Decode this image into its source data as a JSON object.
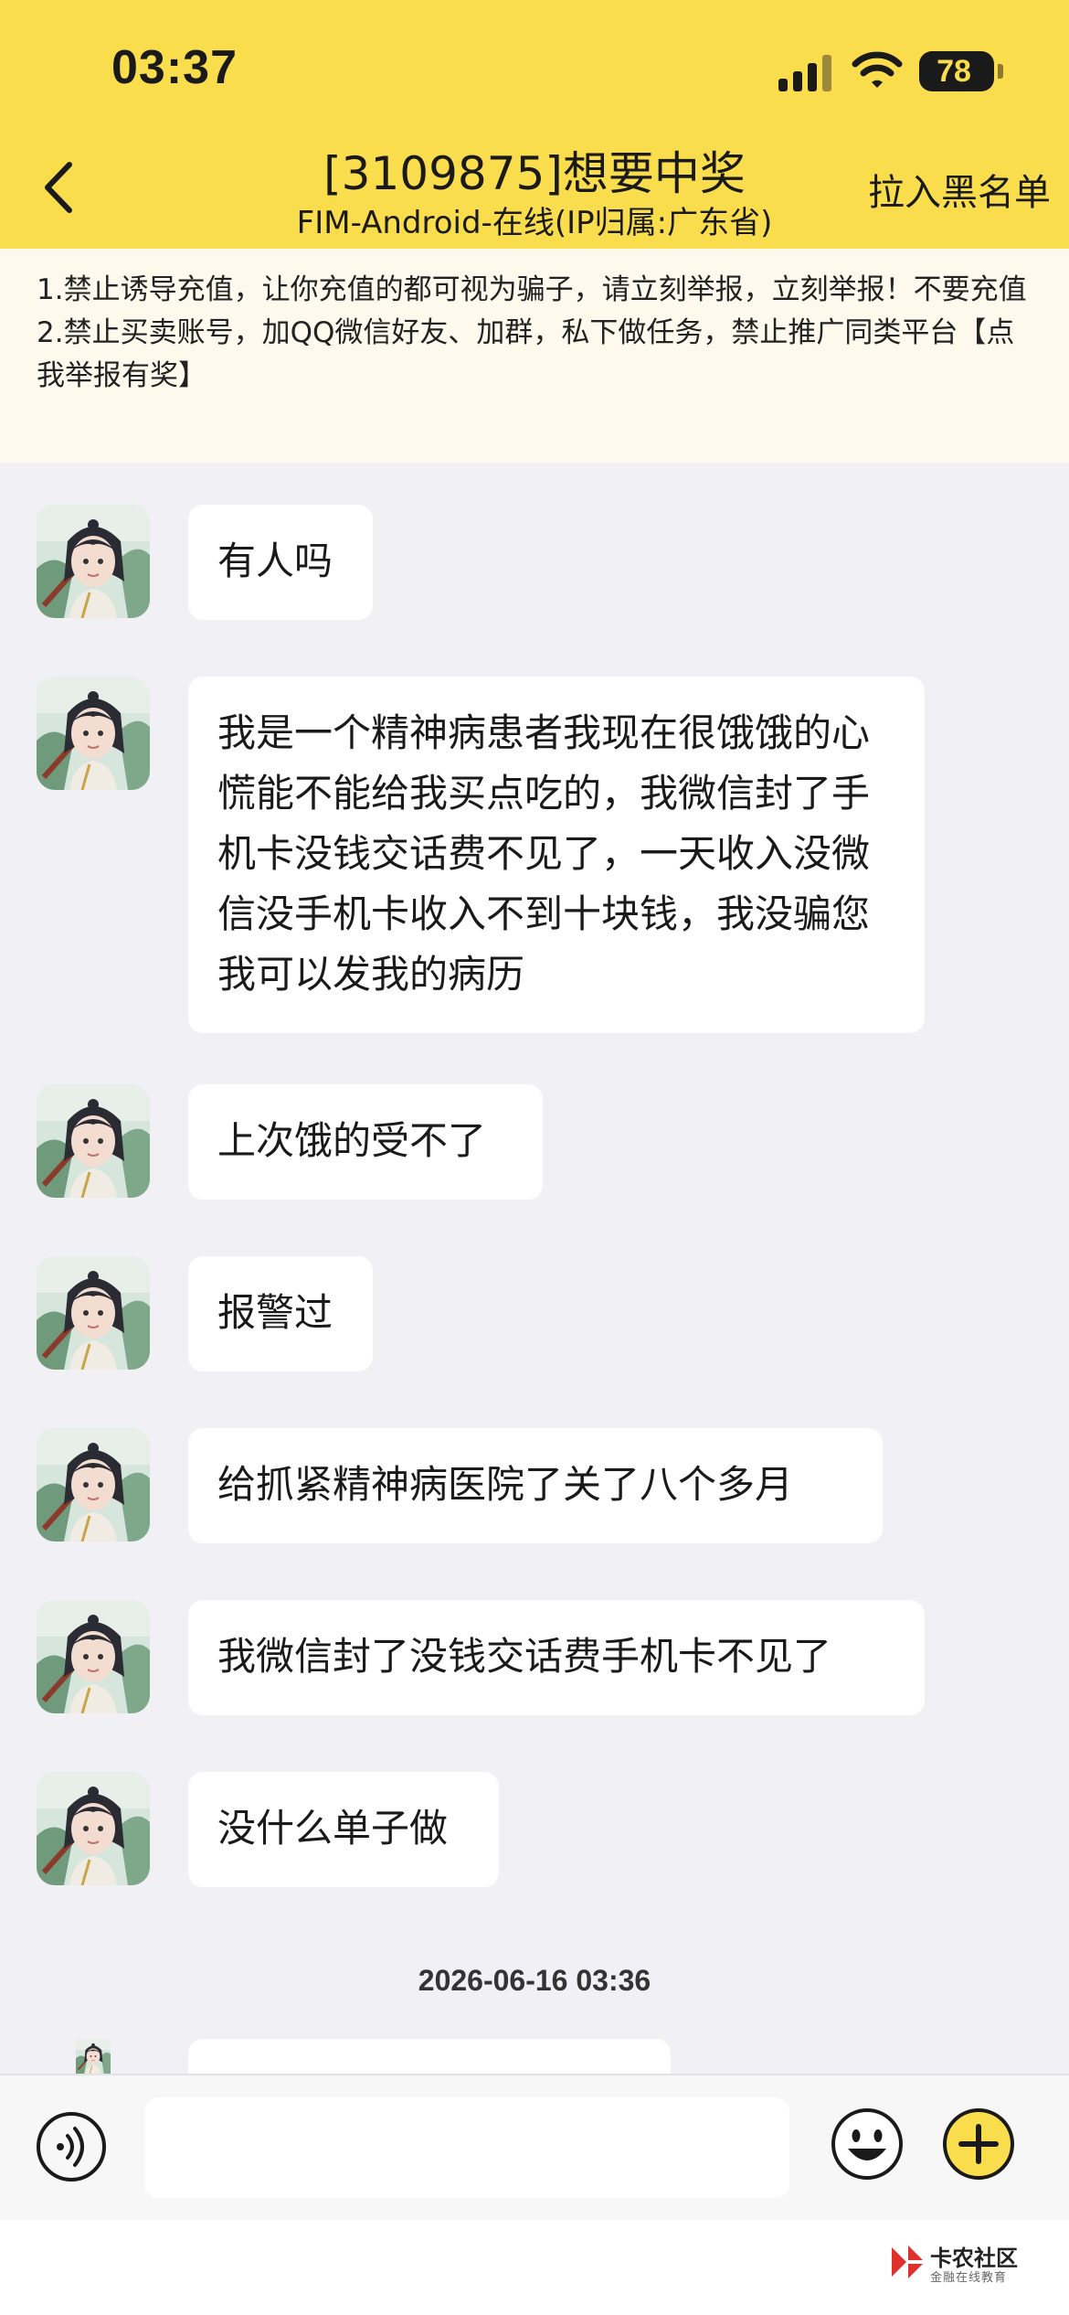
{
  "status_bar": {
    "time": "03:37",
    "battery": "78"
  },
  "header": {
    "title": "[3109875]想要中奖",
    "subtitle": "FIM-Android-在线(IP归属:广东省)",
    "blacklist_label": "拉入黑名单",
    "background": "#f9dd4c"
  },
  "notice": {
    "line1": "1.禁止诱导充值，让你充值的都可视为骗子，请立刻举报，立刻举报！不要充值",
    "line2": "2.禁止买卖账号，加QQ微信好友、加群，私下做任务，禁止推广同类平台【点我举报有奖】"
  },
  "messages": [
    {
      "text": "有人吗"
    },
    {
      "text": "我是一个精神病患者我现在很饿饿的心慌能不能给我买点吃的，我微信封了手机卡没钱交话费不见了，一天收入没微信没手机卡收入不到十块钱，我没骗您我可以发我的病历"
    },
    {
      "text": "上次饿的受不了"
    },
    {
      "text": "报警过"
    },
    {
      "text": "给抓紧精神病医院了关了八个多月"
    },
    {
      "text": "我微信封了没钱交话费手机卡不见了"
    },
    {
      "text": "没什么单子做"
    }
  ],
  "timestamp": "2026-06-16 03:36",
  "input": {
    "placeholder": "",
    "value": ""
  },
  "icons": {
    "back": "back-chevron-icon",
    "voice": "voice-icon",
    "emoji": "emoji-icon",
    "plus": "plus-icon"
  },
  "watermark": {
    "title": "卡农社区",
    "subtitle": "金融在线教育"
  }
}
